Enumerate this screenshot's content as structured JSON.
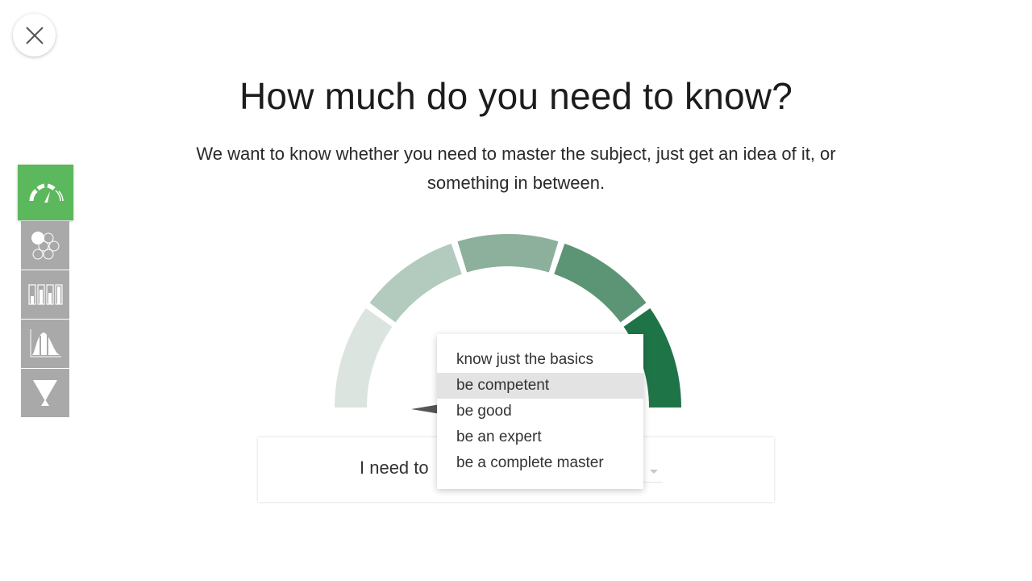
{
  "header": {
    "close_icon": "close-icon"
  },
  "main": {
    "title": "How much do you need to know?",
    "subtitle_line1": "We want to know whether you need to master the subject, just get an idea of it, or",
    "subtitle_line2": "something in between."
  },
  "sidebar": {
    "items": [
      {
        "icon": "gauge-icon",
        "active": true
      },
      {
        "icon": "hexagon-cluster-icon",
        "active": false
      },
      {
        "icon": "bar-levels-icon",
        "active": false
      },
      {
        "icon": "distribution-icon",
        "active": false
      },
      {
        "icon": "funnel-icon",
        "active": false
      }
    ]
  },
  "gauge": {
    "segments": 5,
    "colors": [
      "#dbe4df",
      "#b3cbbe",
      "#8cb09b",
      "#5c9575",
      "#1f7447"
    ]
  },
  "answer": {
    "prefix": "I need to"
  },
  "dropdown": {
    "options": [
      "know just the basics",
      "be competent",
      "be good",
      "be an expert",
      "be a complete master"
    ],
    "highlighted": "be competent"
  },
  "colors": {
    "accent": "#5cb85c",
    "sidebar_inactive": "#a9a9a9"
  }
}
